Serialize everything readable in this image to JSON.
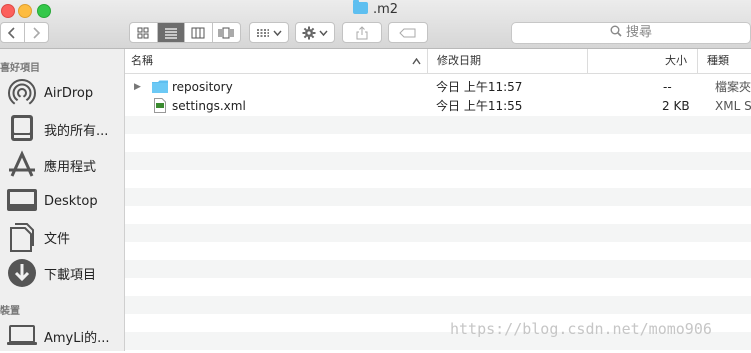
{
  "window": {
    "title": ".m2"
  },
  "toolbar": {
    "back_icon": "chevron-left-icon",
    "forward_icon": "chevron-right-icon",
    "view_modes": [
      "icon-view-icon",
      "list-view-icon",
      "column-view-icon",
      "cover-flow-icon"
    ],
    "active_view": "list",
    "arrange_icon": "grid-arrange-icon",
    "action_icon": "gear-icon",
    "share_icon": "share-icon",
    "tag_icon": "tag-icon",
    "search_placeholder": "搜尋"
  },
  "sidebar": {
    "favorites_header": "喜好項目",
    "favorites": [
      {
        "label": "AirDrop",
        "icon": "airdrop-icon"
      },
      {
        "label": "我的所有...",
        "icon": "all-files-icon"
      },
      {
        "label": "應用程式",
        "icon": "applications-icon"
      },
      {
        "label": "Desktop",
        "icon": "desktop-icon"
      },
      {
        "label": "文件",
        "icon": "documents-icon"
      },
      {
        "label": "下載項目",
        "icon": "downloads-icon"
      }
    ],
    "devices_header": "裝置",
    "devices": [
      {
        "label": "AmyLi的...",
        "icon": "laptop-icon"
      }
    ]
  },
  "columns": {
    "name": "名稱",
    "modified": "修改日期",
    "size": "大小",
    "kind": "種類"
  },
  "files": [
    {
      "name": "repository",
      "modified": "今日 上午11:57",
      "size": "--",
      "kind": "檔案夾",
      "icon": "folder-icon"
    },
    {
      "name": "settings.xml",
      "modified": "今日 上午11:55",
      "size": "2 KB",
      "kind": "XML S",
      "icon": "xml-file-icon"
    }
  ],
  "watermark": "https://blog.csdn.net/momo906"
}
